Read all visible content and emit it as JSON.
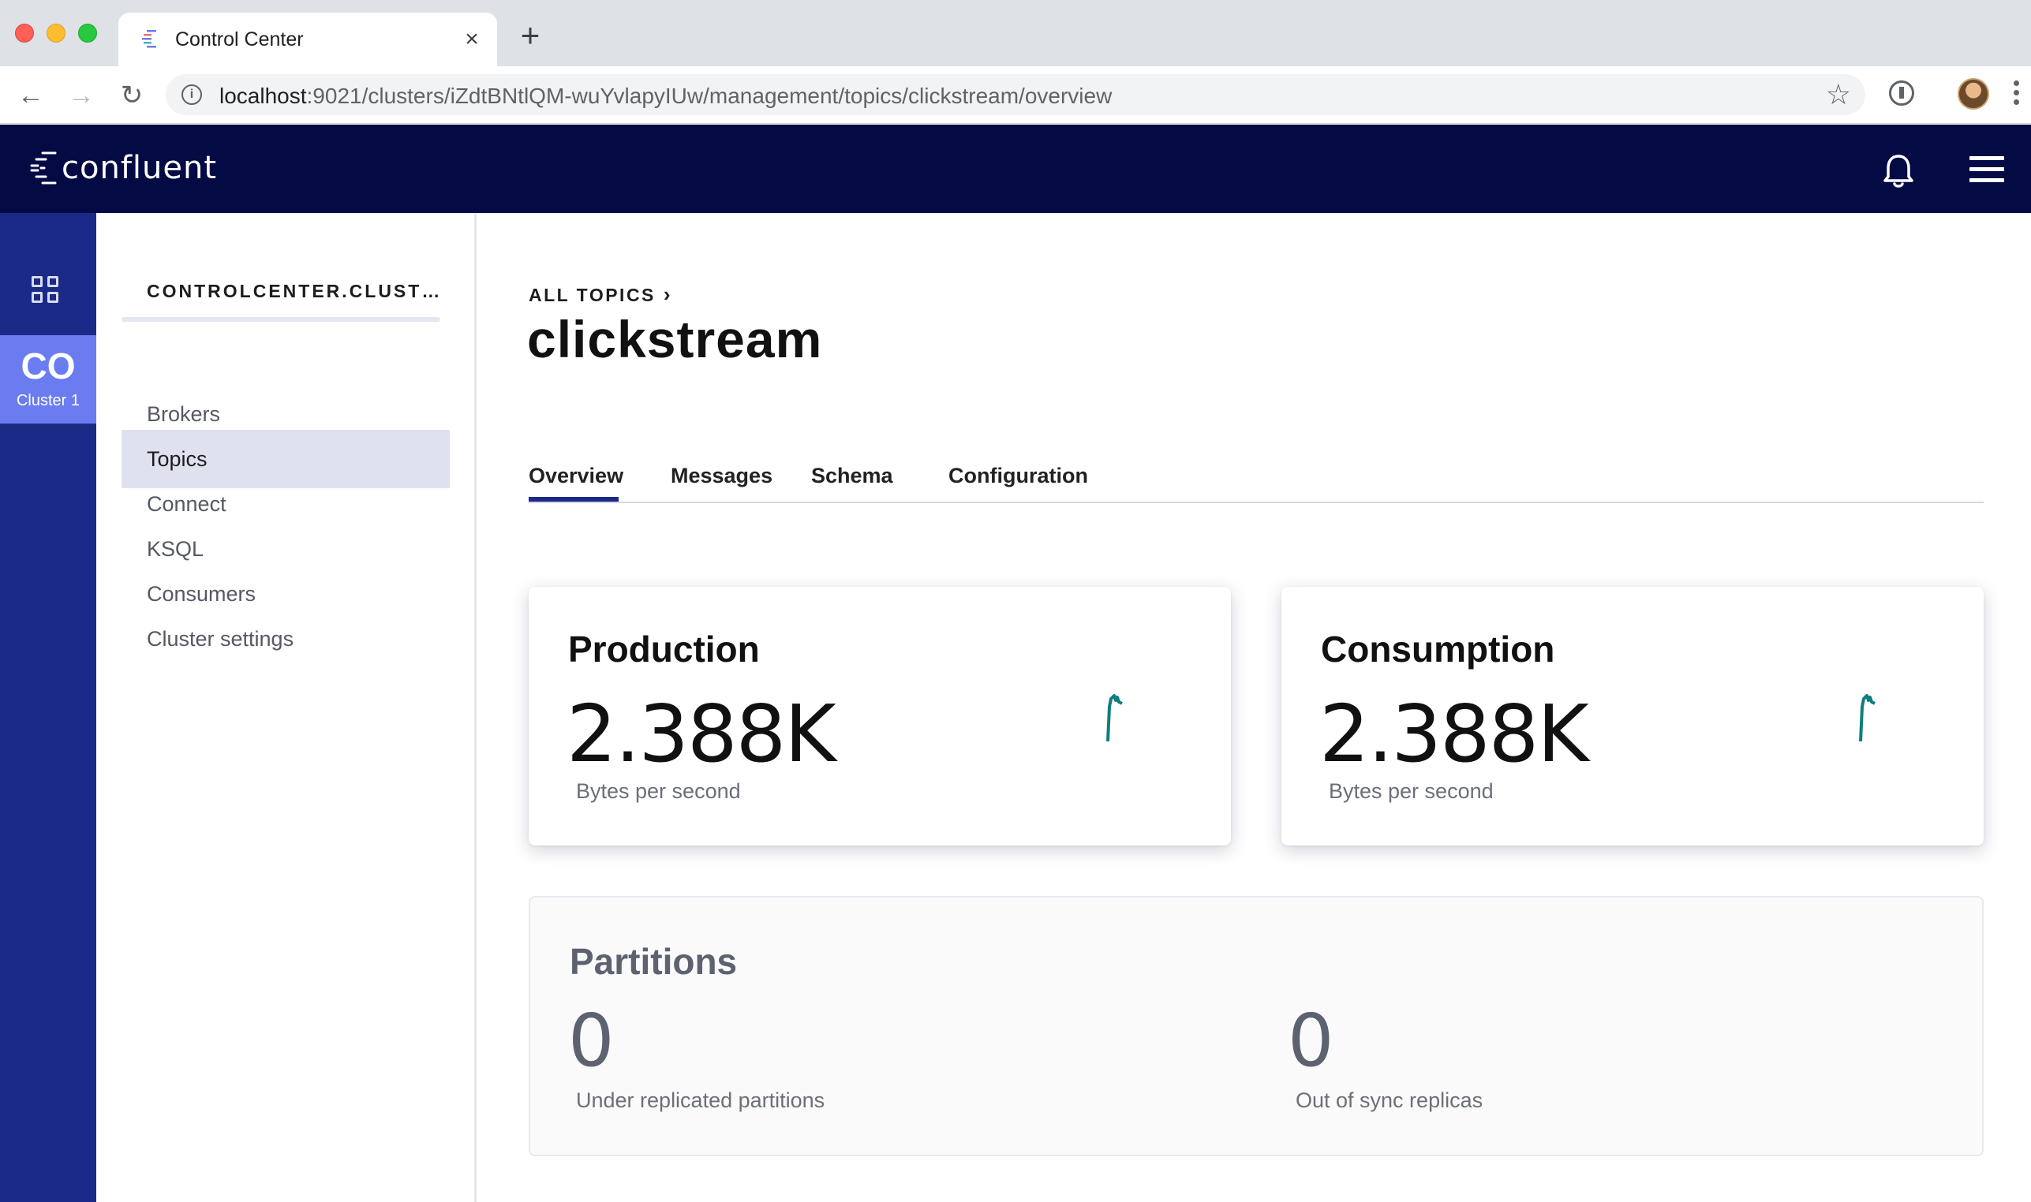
{
  "browser": {
    "tab_title": "Control Center",
    "url_host": "localhost",
    "url_path": ":9021/clusters/iZdtBNtlQM-wuYvlapyIUw/management/topics/clickstream/overview"
  },
  "header": {
    "logo_text": "confluent",
    "brand_color": "#040a44"
  },
  "rail": {
    "cluster_abbr": "CO",
    "cluster_name": "Cluster 1",
    "rail_color": "#1b2a86",
    "chip_color": "#6b7cf1"
  },
  "sidenav": {
    "cluster_title": "CONTROLCENTER.CLUST…",
    "items": [
      {
        "label": "Brokers"
      },
      {
        "label": "Topics"
      },
      {
        "label": "Connect"
      },
      {
        "label": "KSQL"
      },
      {
        "label": "Consumers"
      },
      {
        "label": "Cluster settings"
      }
    ],
    "active_item": "Topics"
  },
  "main": {
    "breadcrumb": "ALL TOPICS",
    "title": "clickstream",
    "tabs": [
      {
        "label": "Overview"
      },
      {
        "label": "Messages"
      },
      {
        "label": "Schema"
      },
      {
        "label": "Configuration"
      }
    ],
    "active_tab": "Overview",
    "production": {
      "title": "Production",
      "value": "2.388K",
      "unit": "Bytes per second"
    },
    "consumption": {
      "title": "Consumption",
      "value": "2.388K",
      "unit": "Bytes per second"
    },
    "sparkline_color": "#0f7d7e",
    "partitions": {
      "title": "Partitions",
      "under_replicated_value": "0",
      "under_replicated_label": "Under replicated partitions",
      "out_of_sync_value": "0",
      "out_of_sync_label": "Out of sync replicas"
    }
  }
}
